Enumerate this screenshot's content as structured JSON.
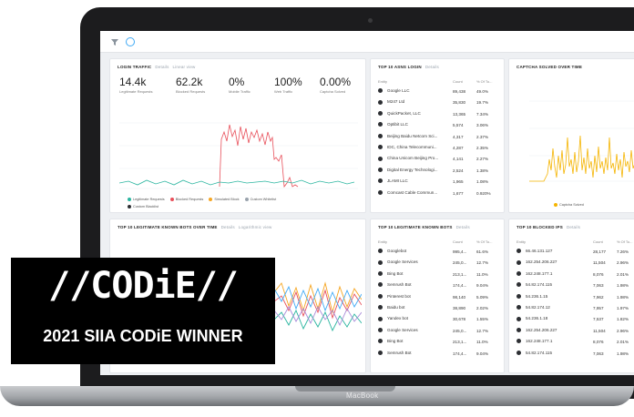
{
  "laptop": {
    "brand_label": "MacBook"
  },
  "login_traffic": {
    "title": "LOGIN TRAFFIC",
    "details_link": "Details",
    "view_select": "Linear view",
    "stats": [
      {
        "value": "14.4k",
        "label": "Legitimate Requests"
      },
      {
        "value": "62.2k",
        "label": "Blocked Requests"
      },
      {
        "value": "0%",
        "label": "Mobile Traffic"
      },
      {
        "value": "100%",
        "label": "Web Traffic"
      },
      {
        "value": "0.00%",
        "label": "Captcha Solved"
      }
    ],
    "legend": [
      "Legitimate Requests",
      "Blocked Requests",
      "Simulated Block",
      "Custom Whitelist",
      "Custom Blacklist"
    ],
    "legend_colors": [
      "#2bb5a0",
      "#e8505b",
      "#f5a623",
      "#9aa3ad",
      "#2d2f33"
    ]
  },
  "top_asns": {
    "title": "TOP 10 ASNS LOGIN",
    "details_link": "Details",
    "headers": [
      "Entity",
      "Count",
      "% Of To..."
    ],
    "rows": [
      {
        "name": "Google LLC",
        "count": "89,438",
        "pct": "49.0%"
      },
      {
        "name": "M247 Ltd",
        "count": "35,830",
        "pct": "19.7%"
      },
      {
        "name": "QuickPacket, LLC",
        "count": "13,365",
        "pct": "7.34%"
      },
      {
        "name": "Optibit LLC",
        "count": "5,574",
        "pct": "3.06%"
      },
      {
        "name": "Beijing Baidu Netcom Sci...",
        "count": "4,317",
        "pct": "2.37%"
      },
      {
        "name": "IDC, China Telecommuni...",
        "count": "4,287",
        "pct": "2.35%"
      },
      {
        "name": "China Unicom Beijing Pro...",
        "count": "4,141",
        "pct": "2.27%"
      },
      {
        "name": "Digital Energy Technologi...",
        "count": "2,524",
        "pct": "1.38%"
      },
      {
        "name": "JLAMI LLC",
        "count": "1,965",
        "pct": "1.08%"
      },
      {
        "name": "Comcast Cable Commun...",
        "count": "1,677",
        "pct": "0.920%"
      }
    ]
  },
  "captcha": {
    "title": "CAPTCHA SOLVED OVER TIME",
    "legend": "Captcha Solved",
    "color": "#f5b400"
  },
  "legit_bots_time": {
    "title": "TOP 10 LEGITIMATE KNOWN BOTS OVER TIME",
    "details_link": "Details",
    "view_select": "Logarithmic view"
  },
  "legit_bots": {
    "title": "TOP 10 LEGITIMATE KNOWN BOTS",
    "details_link": "Details",
    "headers": [
      "Entity",
      "Count",
      "% Of To..."
    ],
    "rows": [
      {
        "name": "Googlebot",
        "count": "995,4...",
        "pct": "61.6%"
      },
      {
        "name": "Google Services",
        "count": "245,0...",
        "pct": "12.7%"
      },
      {
        "name": "Bing Bot",
        "count": "213,1...",
        "pct": "11.0%"
      },
      {
        "name": "Semrush Bot",
        "count": "174,4...",
        "pct": "9.04%"
      },
      {
        "name": "Pinterest bot",
        "count": "98,140",
        "pct": "5.09%"
      },
      {
        "name": "Baidu bot",
        "count": "38,890",
        "pct": "2.02%"
      },
      {
        "name": "Yandex bot",
        "count": "30,678",
        "pct": "1.55%"
      },
      {
        "name": "Google Services",
        "count": "245,0...",
        "pct": "12.7%"
      },
      {
        "name": "Bing Bot",
        "count": "213,1...",
        "pct": "11.0%"
      },
      {
        "name": "Semrush Bot",
        "count": "174,4...",
        "pct": "9.04%"
      }
    ]
  },
  "blocked_ips": {
    "title": "TOP 10 BLOCKED IPS",
    "details_link": "Details",
    "headers": [
      "Entity",
      "Count",
      "% Of To..."
    ],
    "rows": [
      {
        "name": "66.46.131.127",
        "count": "28,177",
        "pct": "7.26%"
      },
      {
        "name": "162.254.206.227",
        "count": "11,504",
        "pct": "2.96%"
      },
      {
        "name": "162.248.177.1",
        "count": "8,076",
        "pct": "2.01%"
      },
      {
        "name": "54.82.174.115",
        "count": "7,063",
        "pct": "1.98%"
      },
      {
        "name": "54.236.1.15",
        "count": "7,962",
        "pct": "1.98%"
      },
      {
        "name": "54.82.174.12",
        "count": "7,957",
        "pct": "1.97%"
      },
      {
        "name": "54.236.1.18",
        "count": "7,537",
        "pct": "1.82%"
      },
      {
        "name": "162.254.206.227",
        "count": "11,504",
        "pct": "2.96%"
      },
      {
        "name": "162.248.177.1",
        "count": "8,076",
        "pct": "2.01%"
      },
      {
        "name": "54.82.174.115",
        "count": "7,063",
        "pct": "1.98%"
      }
    ]
  },
  "award": {
    "logo_text": "//CODiE//",
    "subtitle": "2021 SIIA CODiE WINNER"
  }
}
